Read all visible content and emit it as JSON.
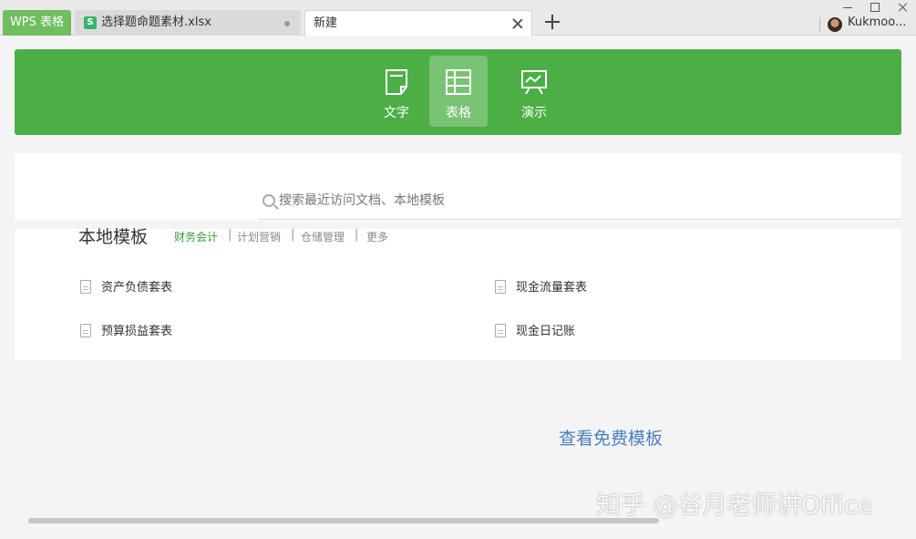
{
  "tabs": {
    "app_label": "WPS 表格",
    "file_icon": "S",
    "file_label": "选择题命题素材.xlsx",
    "new_label": "新建"
  },
  "user": {
    "name": "Kukmoo..."
  },
  "doc_types": [
    {
      "label": "文字",
      "icon": "document-icon"
    },
    {
      "label": "表格",
      "icon": "spreadsheet-icon",
      "active": true
    },
    {
      "label": "演示",
      "icon": "presentation-icon"
    }
  ],
  "search": {
    "placeholder": "搜索最近访问文档、本地模板"
  },
  "templates": {
    "title": "本地模板",
    "categories": [
      "财务会计",
      "计划营销",
      "仓储管理",
      "更多"
    ],
    "separator": "|",
    "items": [
      "资产负债套表",
      "现金流量套表",
      "预算损益套表",
      "现金日记账"
    ]
  },
  "free_templates_label": "查看免费模板",
  "watermark": "知乎 @谷月老师讲Office",
  "colors": {
    "brand_green": "#4caf46",
    "link_blue": "#4a7fc1",
    "active_category": "#3a9a3a"
  }
}
